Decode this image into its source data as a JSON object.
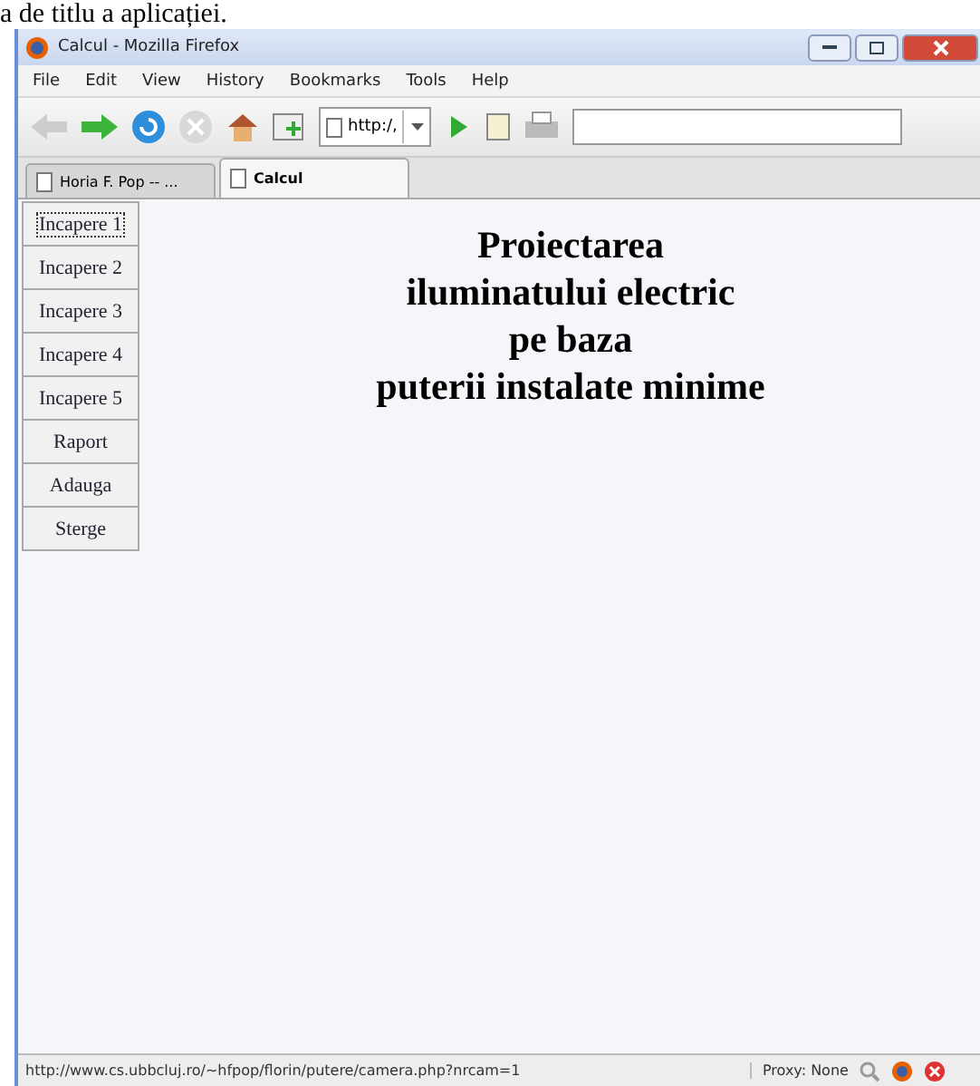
{
  "caption": "a de titlu a aplicației.",
  "window": {
    "title": "Calcul - Mozilla Firefox"
  },
  "menu": [
    "File",
    "Edit",
    "View",
    "History",
    "Bookmarks",
    "Tools",
    "Help"
  ],
  "address": {
    "value": "http:/,"
  },
  "tabs": [
    {
      "label": "Horia F. Pop -- ...",
      "selected": false
    },
    {
      "label": "Calcul",
      "selected": true
    }
  ],
  "nav": [
    {
      "label": "Incapere 1",
      "selected": true
    },
    {
      "label": "Incapere 2",
      "selected": false
    },
    {
      "label": "Incapere 3",
      "selected": false
    },
    {
      "label": "Incapere 4",
      "selected": false
    },
    {
      "label": "Incapere 5",
      "selected": false
    },
    {
      "label": "Raport",
      "selected": false
    },
    {
      "label": "Adauga",
      "selected": false
    },
    {
      "label": "Sterge",
      "selected": false
    }
  ],
  "heading": [
    "Proiectarea",
    "iluminatului electric",
    "pe baza",
    "puterii instalate minime"
  ],
  "status_bar": {
    "url": "http://www.cs.ubbcluj.ro/~hfpop/florin/putere/camera.php?nrcam=1",
    "proxy": "Proxy: None"
  }
}
